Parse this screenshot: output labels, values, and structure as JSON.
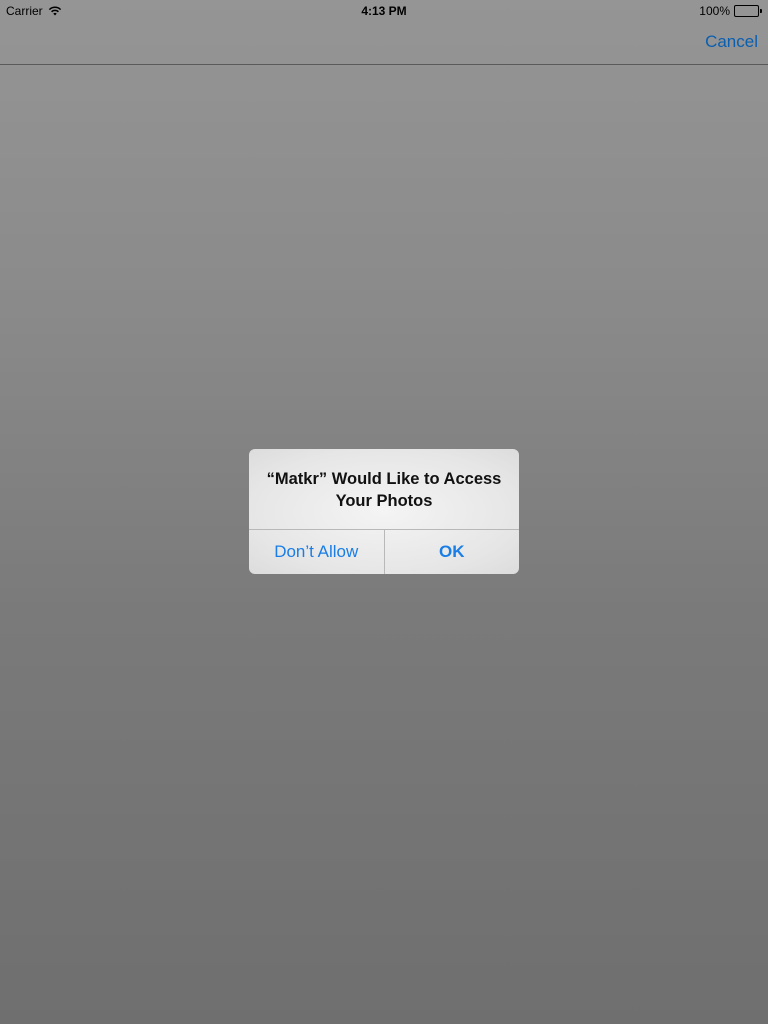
{
  "status_bar": {
    "carrier": "Carrier",
    "time": "4:13 PM",
    "battery": "100%",
    "icons": [
      "wifi-icon",
      "battery-icon"
    ]
  },
  "nav_bar": {
    "cancel_label": "Cancel"
  },
  "alert": {
    "title": "“Matkr” Would Like to Access Your Photos",
    "dont_allow_label": "Don’t Allow",
    "ok_label": "OK"
  },
  "colors": {
    "accent": "#1a7ee6",
    "nav_link": "#0b5fb0"
  }
}
